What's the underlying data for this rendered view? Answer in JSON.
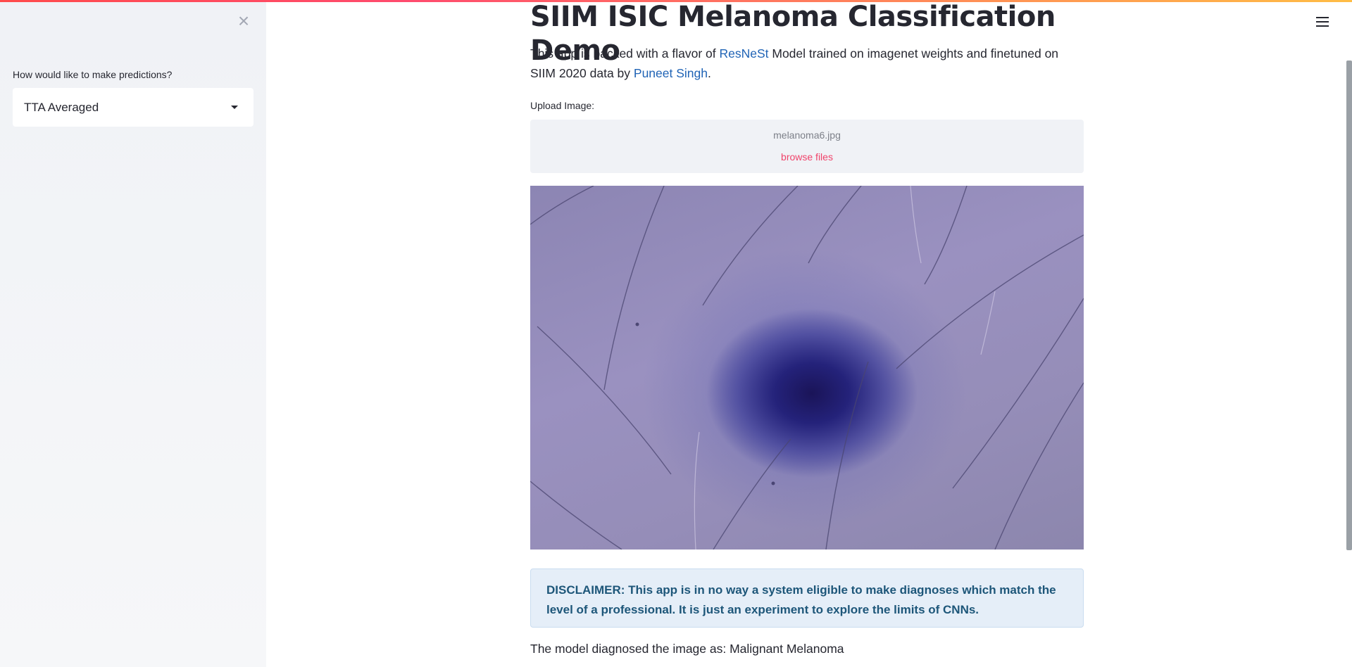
{
  "sidebar": {
    "close_symbol": "×",
    "select_label": "How would like to make predictions?",
    "select_value": "TTA Averaged"
  },
  "main": {
    "title": "SIIM ISIC Melanoma Classification Demo",
    "intro": {
      "prefix": "This app is backed with a flavor of ",
      "link1": "ResNeSt",
      "middle": " Model trained on imagenet weights and finetuned on SIIM 2020 data by ",
      "link2": "Puneet Singh",
      "suffix": "."
    },
    "upload_label": "Upload Image:",
    "uploader": {
      "file_name": "melanoma6.jpg",
      "browse_label": "browse files"
    },
    "disclaimer": "DISCLAIMER: This app is in no way a system eligible to make diagnoses which match the level of a professional. It is just an experiment to explore the limits of CNNs.",
    "result": "The model diagnosed the image as: Malignant Melanoma"
  },
  "icons": [
    "close-icon",
    "chevron-down-icon",
    "hamburger-menu-icon"
  ],
  "colors": {
    "accent": "#ff4b4b",
    "link": "#1f63b5",
    "browse": "#f0446b",
    "info_bg": "#e5eef8",
    "info_text": "#1d5679"
  }
}
